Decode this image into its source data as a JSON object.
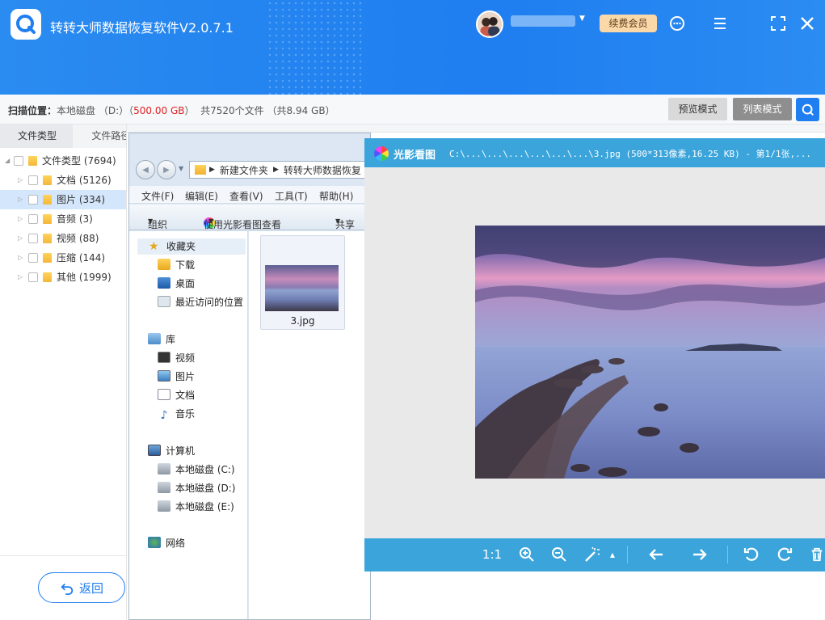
{
  "app": {
    "title": "转转大师数据恢复软件V2.0.7.1",
    "renew_label": "续费会员"
  },
  "scan": {
    "label": "扫描位置：",
    "disk": "本地磁盘 （D:）",
    "size_open": "（",
    "size": "500.00 GB",
    "size_close": "）",
    "summary": "共7520个文件 （共8.94 GB）",
    "preview_mode": "预览模式",
    "list_mode": "列表模式"
  },
  "left_panel": {
    "tabs": [
      "文件类型",
      "文件路径"
    ],
    "tree": [
      {
        "label": "文件类型 (7694)",
        "level": 0,
        "selected": false
      },
      {
        "label": "文档 (5126)",
        "level": 1,
        "selected": false
      },
      {
        "label": "图片 (334)",
        "level": 1,
        "selected": true
      },
      {
        "label": "音频 (3)",
        "level": 1,
        "selected": false
      },
      {
        "label": "视频 (88)",
        "level": 1,
        "selected": false
      },
      {
        "label": "压缩 (144)",
        "level": 1,
        "selected": false
      },
      {
        "label": "其他 (1999)",
        "level": 1,
        "selected": false
      }
    ],
    "back_label": "返回"
  },
  "explorer": {
    "address": [
      "新建文件夹",
      "转转大师数据恢复"
    ],
    "menu": [
      "文件(F)",
      "编辑(E)",
      "查看(V)",
      "工具(T)",
      "帮助(H)"
    ],
    "toolbar": {
      "organize": "组织",
      "open_with": "使用光影看图查看",
      "share": "共享"
    },
    "nav": {
      "favorites": "收藏夹",
      "downloads": "下载",
      "desktop": "桌面",
      "recent": "最近访问的位置",
      "library": "库",
      "videos": "视频",
      "pictures": "图片",
      "documents": "文档",
      "music": "音乐",
      "computer": "计算机",
      "disk_c": "本地磁盘 (C:)",
      "disk_d": "本地磁盘 (D:)",
      "disk_e": "本地磁盘 (E:)",
      "network": "网络"
    },
    "file": {
      "name": "3.jpg"
    }
  },
  "viewer": {
    "app_name": "光影看图",
    "path_info": "C:\\...\\...\\...\\...\\...\\...\\3.jpg (500*313像素,16.25 KB) - 第1/1张,...",
    "zoom_label": "1:1"
  },
  "colors": {
    "brand": "#1f7ef0",
    "viewer_blue": "#3aa4db",
    "size_red": "#e02020",
    "renew_bg": "#fbd8a8"
  },
  "icons": [
    "logo-icon",
    "avatar",
    "chevron-down-icon",
    "support-icon",
    "menu-icon",
    "fullscreen-icon",
    "close-icon",
    "search-icon",
    "folder-icon",
    "undo-icon",
    "star-icon",
    "zoom-in-icon",
    "zoom-out-icon",
    "magic-icon",
    "arrow-left-icon",
    "arrow-right-icon",
    "rotate-left-icon",
    "rotate-right-icon",
    "delete-icon"
  ]
}
